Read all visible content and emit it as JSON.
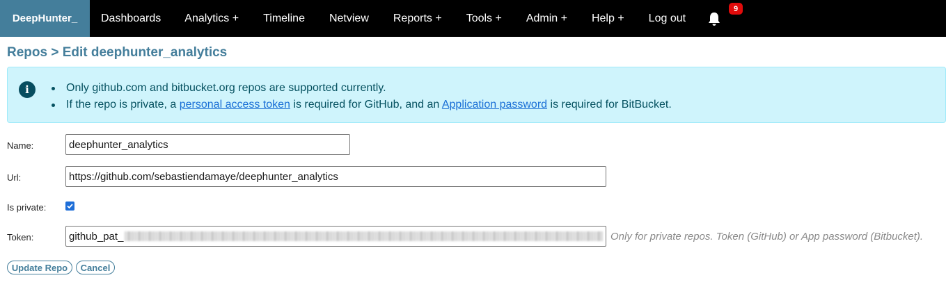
{
  "nav": {
    "brand": "DeepHunter_",
    "items": [
      "Dashboards",
      "Analytics +",
      "Timeline",
      "Netview",
      "Reports +",
      "Tools +",
      "Admin +",
      "Help +",
      "Log out"
    ],
    "notification_count": "9"
  },
  "breadcrumb": "Repos > Edit deephunter_analytics",
  "info": {
    "line1": "Only github.com and bitbucket.org repos are supported currently.",
    "line2_pre": "If the repo is private, a ",
    "line2_link1": "personal access token",
    "line2_mid": " is required for GitHub, and an ",
    "line2_link2": "Application password",
    "line2_post": " is required for BitBucket."
  },
  "form": {
    "name_label": "Name:",
    "name_value": "deephunter_analytics",
    "url_label": "Url:",
    "url_value": "https://github.com/sebastiendamaye/deephunter_analytics",
    "private_label": "Is private:",
    "is_private": true,
    "token_label": "Token:",
    "token_prefix": "github_pat_",
    "token_help": "Only for private repos. Token (GitHub) or App password (Bitbucket)."
  },
  "buttons": {
    "update": "Update Repo",
    "cancel": "Cancel"
  },
  "colors": {
    "brand_bg": "#447e9b",
    "navbar_bg": "#000000",
    "info_bg": "#cff4fc",
    "badge_bg": "#e10b0b",
    "checkbox": "#1e6ed8"
  }
}
